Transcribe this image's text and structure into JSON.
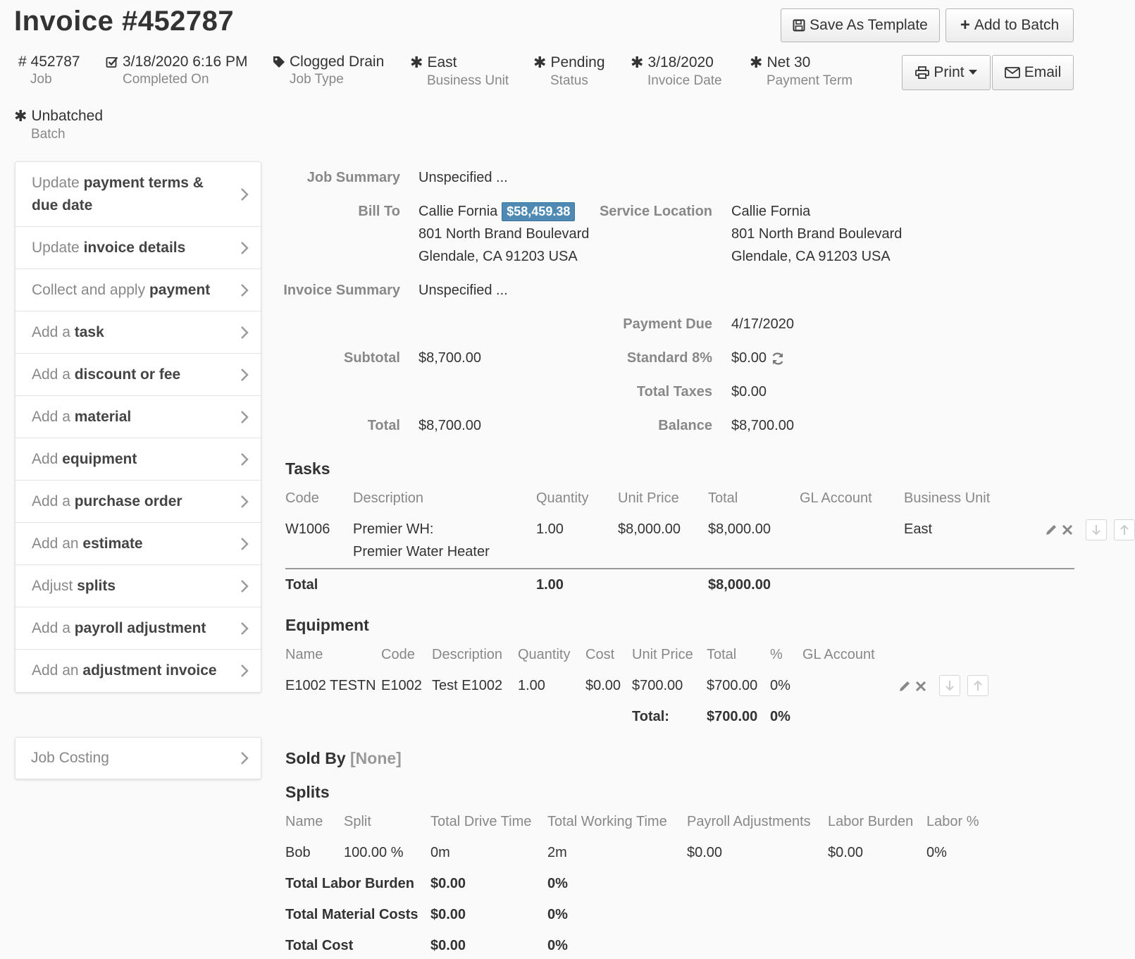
{
  "header": {
    "title": "Invoice #452787",
    "save_template": "Save As Template",
    "add_batch": "Add to Batch",
    "print": "Print",
    "email": "Email"
  },
  "meta": {
    "job": {
      "value": "# 452787",
      "label": "Job"
    },
    "completed": {
      "value": "3/18/2020 6:16 PM",
      "label": "Completed On"
    },
    "job_type": {
      "value": "Clogged Drain",
      "label": "Job Type"
    },
    "business_unit": {
      "value": "East",
      "label": "Business Unit"
    },
    "status": {
      "value": "Pending",
      "label": "Status"
    },
    "invoice_date": {
      "value": "3/18/2020",
      "label": "Invoice Date"
    },
    "payment_term": {
      "value": "Net 30",
      "label": "Payment Term"
    },
    "batch": {
      "value": "Unbatched",
      "label": "Batch"
    }
  },
  "sidebar": {
    "items": [
      {
        "pre": "Update ",
        "bold": "payment terms & due date"
      },
      {
        "pre": "Update ",
        "bold": "invoice details"
      },
      {
        "pre": "Collect and apply ",
        "bold": "payment"
      },
      {
        "pre": "Add a ",
        "bold": "task"
      },
      {
        "pre": "Add a ",
        "bold": "discount or fee"
      },
      {
        "pre": "Add a ",
        "bold": "material"
      },
      {
        "pre": "Add ",
        "bold": "equipment"
      },
      {
        "pre": "Add a ",
        "bold": "purchase order"
      },
      {
        "pre": "Add an ",
        "bold": "estimate"
      },
      {
        "pre": "Adjust ",
        "bold": "splits"
      },
      {
        "pre": "Add a ",
        "bold": "payroll adjustment"
      },
      {
        "pre": "Add an ",
        "bold": "adjustment invoice"
      }
    ],
    "job_costing": "Job Costing"
  },
  "summary": {
    "job_summary_label": "Job Summary",
    "job_summary": "Unspecified ...",
    "bill_to_label": "Bill To",
    "bill_to_name": "Callie Fornia",
    "bill_to_badge": "$58,459.38",
    "bill_to_line1": "801 North Brand Boulevard",
    "bill_to_line2": "Glendale, CA 91203 USA",
    "service_location_label": "Service Location",
    "service_name": "Callie Fornia",
    "service_line1": "801 North Brand Boulevard",
    "service_line2": "Glendale, CA 91203 USA",
    "invoice_summary_label": "Invoice Summary",
    "invoice_summary": "Unspecified ...",
    "payment_due_label": "Payment Due",
    "payment_due": "4/17/2020",
    "subtotal_label": "Subtotal",
    "subtotal": "$8,700.00",
    "standard_label": "Standard 8%",
    "standard": "$0.00",
    "total_taxes_label": "Total Taxes",
    "total_taxes": "$0.00",
    "total_label": "Total",
    "total": "$8,700.00",
    "balance_label": "Balance",
    "balance": "$8,700.00"
  },
  "tasks": {
    "title": "Tasks",
    "headers": [
      "Code",
      "Description",
      "Quantity",
      "Unit Price",
      "Total",
      "GL Account",
      "Business Unit"
    ],
    "row": {
      "code": "W1006",
      "desc1": "Premier WH:",
      "desc2": "Premier Water Heater",
      "qty": "1.00",
      "unit": "$8,000.00",
      "total": "$8,000.00",
      "bu": "East"
    },
    "total_label": "Total",
    "total_qty": "1.00",
    "total_amount": "$8,000.00"
  },
  "equipment": {
    "title": "Equipment",
    "headers": [
      "Name",
      "Code",
      "Description",
      "Quantity",
      "Cost",
      "Unit Price",
      "Total",
      "%",
      "GL Account"
    ],
    "row": {
      "name": "E1002 TESTN",
      "code": "E1002",
      "desc": "Test E1002",
      "qty": "1.00",
      "cost": "$0.00",
      "unit": "$700.00",
      "total": "$700.00",
      "pct": "0%"
    },
    "total_label": "Total:",
    "total_amount": "$700.00",
    "total_pct": "0%"
  },
  "sold_by": {
    "label": "Sold By",
    "value": "[None]"
  },
  "splits": {
    "title": "Splits",
    "headers": [
      "Name",
      "Split",
      "Total Drive Time",
      "Total Working Time",
      "Payroll Adjustments",
      "Labor Burden",
      "Labor %"
    ],
    "row": {
      "name": "Bob",
      "split": "100.00 %",
      "drive": "0m",
      "working": "2m",
      "payroll": "$0.00",
      "burden": "$0.00",
      "labor": "0%"
    },
    "totals": [
      {
        "label": "Total Labor Burden",
        "amount": "$0.00",
        "pct": "0%"
      },
      {
        "label": "Total Material Costs",
        "amount": "$0.00",
        "pct": "0%"
      },
      {
        "label": "Total Cost",
        "amount": "$0.00",
        "pct": "0%"
      }
    ]
  }
}
